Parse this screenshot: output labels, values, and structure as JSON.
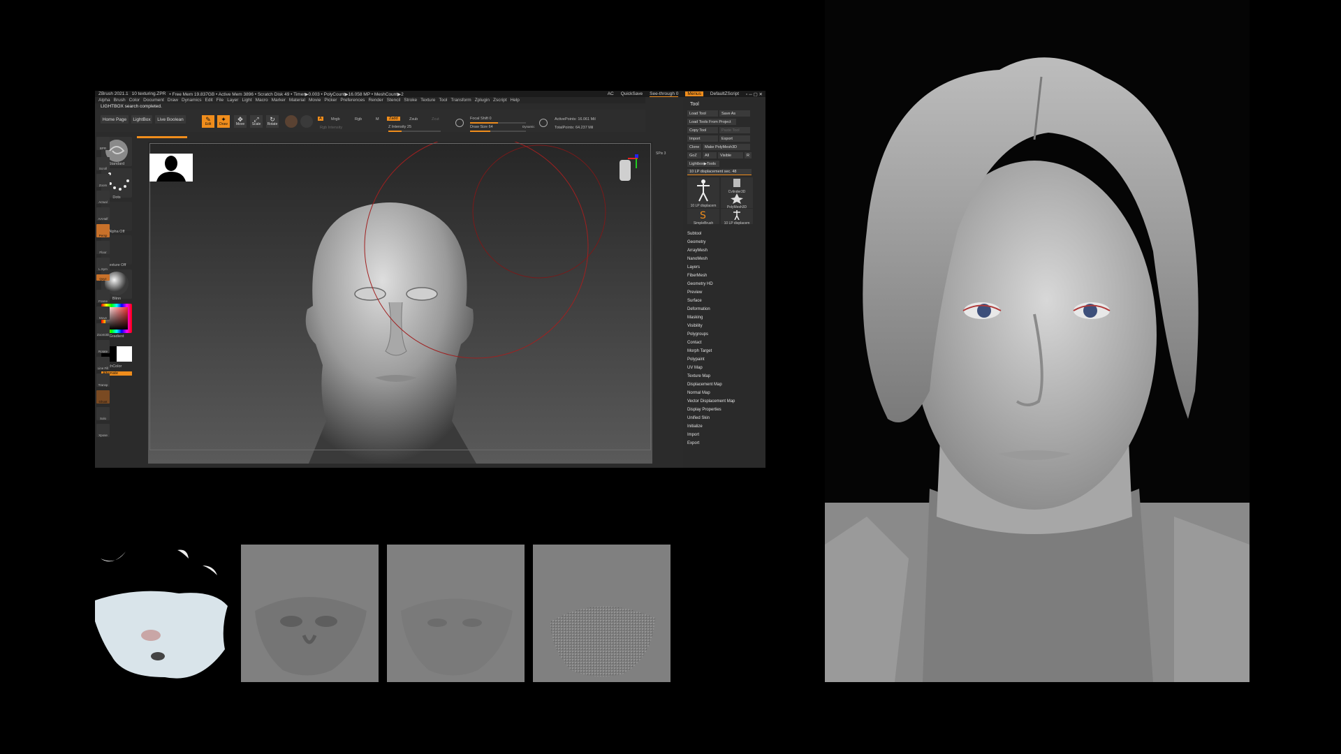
{
  "titlebar": {
    "app": "ZBrush 2021.1",
    "file": "10 texturing.ZPR",
    "stats": "• Free Mem 19.837GB • Active Mem 3896 • Scratch Disk 49 • Timer▶0.003 • PolyCount▶16.058 MP • MeshCount▶2",
    "ac": "AC",
    "quicksave": "QuickSave",
    "seethrough": "See-through  0",
    "menus": "Menus",
    "script": "DefaultZScript"
  },
  "menubar": [
    "Alpha",
    "Brush",
    "Color",
    "Document",
    "Draw",
    "Dynamics",
    "Edit",
    "File",
    "Layer",
    "Light",
    "Macro",
    "Marker",
    "Material",
    "Movie",
    "Picker",
    "Preferences",
    "Render",
    "Stencil",
    "Stroke",
    "Texture",
    "Tool",
    "Transform",
    "Zplugin",
    "Zscript",
    "Help"
  ],
  "status": "LIGHTBOX search completed.",
  "topshelf": {
    "home": "Home Page",
    "lightbox": "LightBox",
    "liveboolean": "Live Boolean",
    "edit": "Edit",
    "draw": "Draw",
    "move": "Move",
    "scale": "Scale",
    "rotate": "Rotate",
    "a": "A",
    "mrgb": "Mrgb",
    "rgb": "Rgb",
    "m": "M",
    "rgbintensity": "Rgb Intensity",
    "zadd": "Zadd",
    "zsub": "Zsub",
    "zcut": "Zcut",
    "zintensity": "Z Intensity 25",
    "focalshift": "Focal Shift 0",
    "drawsize": "Draw Size 64",
    "dynamic": "Dynamic",
    "activepoints": "ActivePoints: 16.061 Mil",
    "totalpoints": "TotalPoints: 64.237 Mil"
  },
  "leftshelf": {
    "standard": "Standard",
    "dots": "Dots",
    "alphaoff": "Alpha Off",
    "textureoff": "Texture Off",
    "material": "Blinn",
    "gradient": "Gradient",
    "switchcolor": "SwitchColor",
    "alternate": "Alternate"
  },
  "rightshelf": [
    "BPR",
    "SPix 3",
    "Scroll",
    "Zoom",
    "Actual",
    "AAHalf",
    "Persp",
    "Floor",
    "L.Sym",
    "Qxyz",
    "Frame",
    "Move",
    "Zoom3D",
    "Rotate",
    "Line Fill",
    "Transp",
    "Ghost",
    "Solo",
    "Xpose"
  ],
  "toolpanel": {
    "title": "Tool",
    "loadtool": "Load Tool",
    "saveas": "Save As",
    "loadfromproject": "Load Tools From Project",
    "copytool": "Copy Tool",
    "pastetool": "Paste Tool",
    "import": "Import",
    "export": "Export",
    "clone": "Clone",
    "makepolymesh": "Make PolyMesh3D",
    "goz": "GoZ",
    "all": "All",
    "visible": "Visible",
    "r": "R",
    "lightboxtools": "Lightbox▶Tools",
    "current": "10 LP displacement sec. 48",
    "t1": "10 LP displacem",
    "t2": "Cylinder3D",
    "t3": "PolyMesh3D",
    "t4": "SimpleBrush",
    "t5": "10 LP displacem",
    "list": [
      "Subtool",
      "Geometry",
      "ArrayMesh",
      "NanoMesh",
      "Layers",
      "FiberMesh",
      "Geometry HD",
      "Preview",
      "Surface",
      "Deformation",
      "Masking",
      "Visibility",
      "Polygroups",
      "Contact",
      "Morph Target",
      "Polypaint",
      "UV Map",
      "Texture Map",
      "Displacement Map",
      "Normal Map",
      "Vector Displacement Map",
      "Display Properties",
      "Unified Skin",
      "Initialize",
      "Import",
      "Export"
    ]
  },
  "colors": {
    "accent": "#f08d1c",
    "bg": "#000000",
    "panel": "#2b2b2b"
  }
}
